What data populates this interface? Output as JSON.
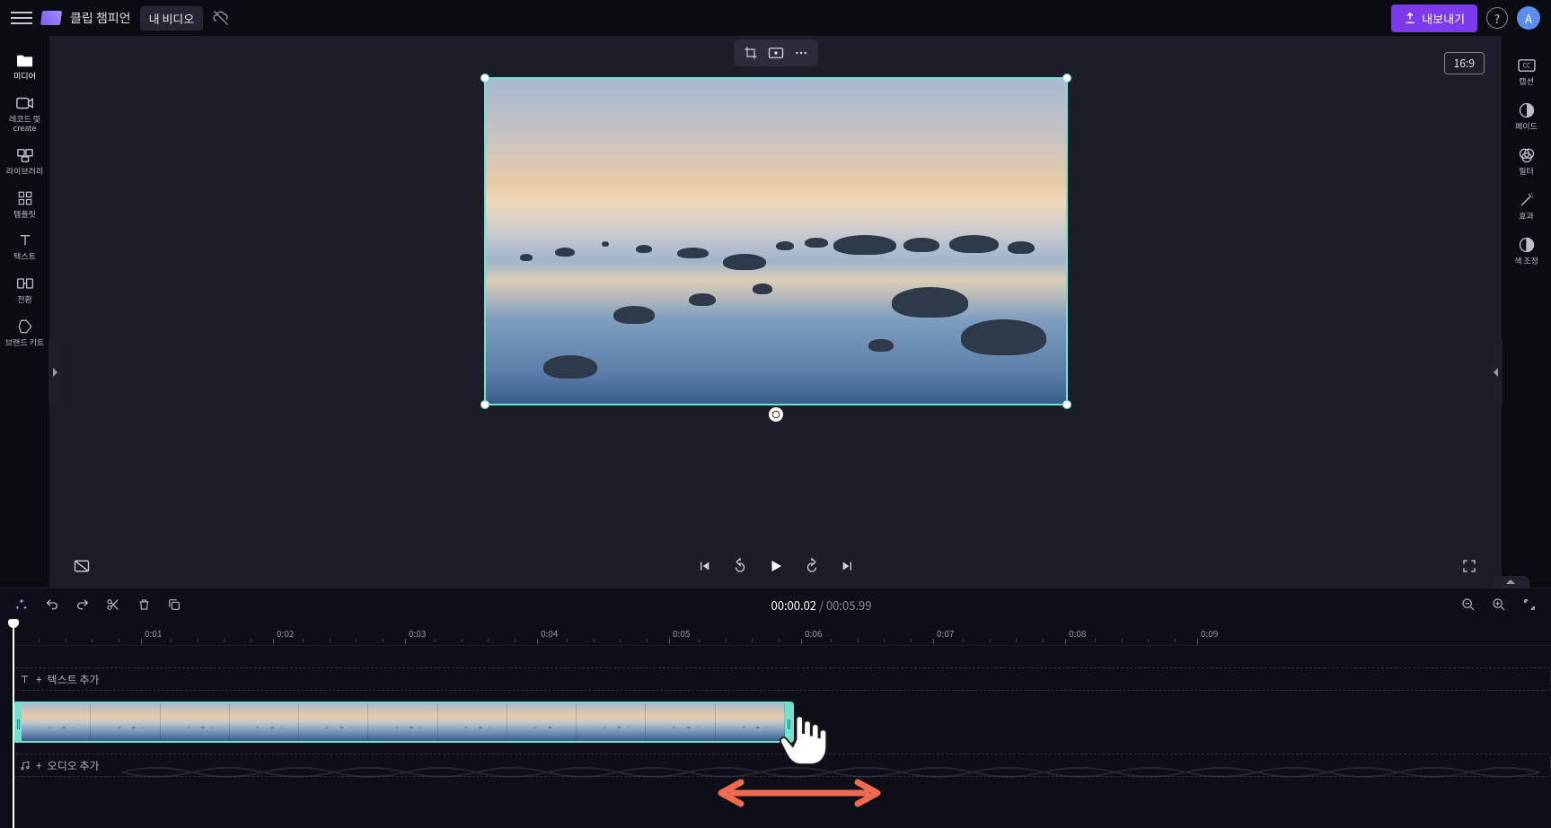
{
  "header": {
    "brand": "클립 챔피언",
    "project_name": "내 비디오",
    "export_label": "내보내기",
    "avatar_initial": "A",
    "aspect_ratio": "16:9"
  },
  "left_rail": [
    {
      "id": "media",
      "label": "미디어",
      "icon": "folder"
    },
    {
      "id": "record",
      "label": "레코드 및 create",
      "icon": "camera"
    },
    {
      "id": "library",
      "label": "라이브러리",
      "icon": "library"
    },
    {
      "id": "templates",
      "label": "템플릿",
      "icon": "grid"
    },
    {
      "id": "text",
      "label": "텍스트",
      "icon": "text"
    },
    {
      "id": "transition",
      "label": "전환",
      "icon": "transition"
    },
    {
      "id": "brandkit",
      "label": "브랜드 키트",
      "icon": "tag"
    }
  ],
  "right_rail": [
    {
      "id": "captions",
      "label": "캡션",
      "icon": "cc"
    },
    {
      "id": "fade",
      "label": "페이드",
      "icon": "fade"
    },
    {
      "id": "filters",
      "label": "필터",
      "icon": "filter"
    },
    {
      "id": "effects",
      "label": "효과",
      "icon": "wand"
    },
    {
      "id": "coloradj",
      "label": "색 조정",
      "icon": "contrast"
    }
  ],
  "timeline": {
    "current": "00:00.02",
    "separator": "/",
    "duration": "00:05.99",
    "ticks": [
      "0:01",
      "0:02",
      "0:03",
      "0:04",
      "0:05",
      "0:06",
      "0:07",
      "0:08",
      "0:09"
    ],
    "text_track_label": "텍스트 추가",
    "audio_track_label": "오디오 추가"
  },
  "accent": "#7c3aed",
  "selection_color": "#6fe3d0"
}
